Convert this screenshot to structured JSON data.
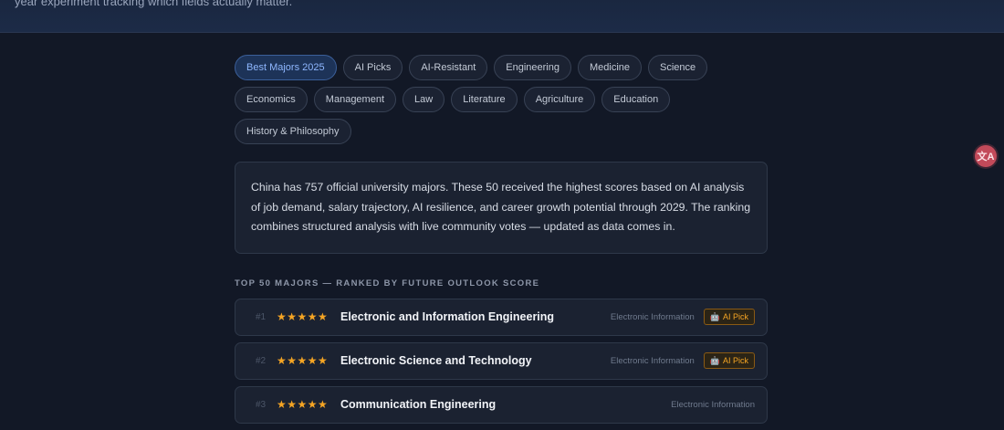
{
  "header": {
    "subtitle": "year experiment tracking which fields actually matter."
  },
  "filters": [
    {
      "label": "Best Majors 2025",
      "active": true
    },
    {
      "label": "AI Picks",
      "active": false
    },
    {
      "label": "AI-Resistant",
      "active": false
    },
    {
      "label": "Engineering",
      "active": false
    },
    {
      "label": "Medicine",
      "active": false
    },
    {
      "label": "Science",
      "active": false
    },
    {
      "label": "Economics",
      "active": false
    },
    {
      "label": "Management",
      "active": false
    },
    {
      "label": "Law",
      "active": false
    },
    {
      "label": "Literature",
      "active": false
    },
    {
      "label": "Agriculture",
      "active": false
    },
    {
      "label": "Education",
      "active": false
    },
    {
      "label": "History & Philosophy",
      "active": false
    }
  ],
  "intro": {
    "text": "China has 757 official university majors. These 50 received the highest scores based on AI analysis of job demand, salary trajectory, AI resilience, and career growth potential through 2029. The ranking combines structured analysis with live community votes — updated as data comes in."
  },
  "ranking": {
    "section_label": "TOP 50 MAJORS — RANKED BY FUTURE OUTLOOK SCORE",
    "badge_label": "AI Pick",
    "items": [
      {
        "rank": "#1",
        "stars": "★★★★★",
        "name": "Electronic and Information Engineering",
        "category": "Electronic Information",
        "ai_pick": true
      },
      {
        "rank": "#2",
        "stars": "★★★★★",
        "name": "Electronic Science and Technology",
        "category": "Electronic Information",
        "ai_pick": true
      },
      {
        "rank": "#3",
        "stars": "★★★★★",
        "name": "Communication Engineering",
        "category": "Electronic Information",
        "ai_pick": false
      }
    ]
  },
  "colors": {
    "background": "#121826",
    "card": "#1b2231",
    "accent_blue": "#8fb7ff",
    "star": "#f5a524",
    "translate_button": "#c24a5a"
  },
  "icons": {
    "badge": "robot-icon",
    "floating_button": "translate-icon"
  }
}
